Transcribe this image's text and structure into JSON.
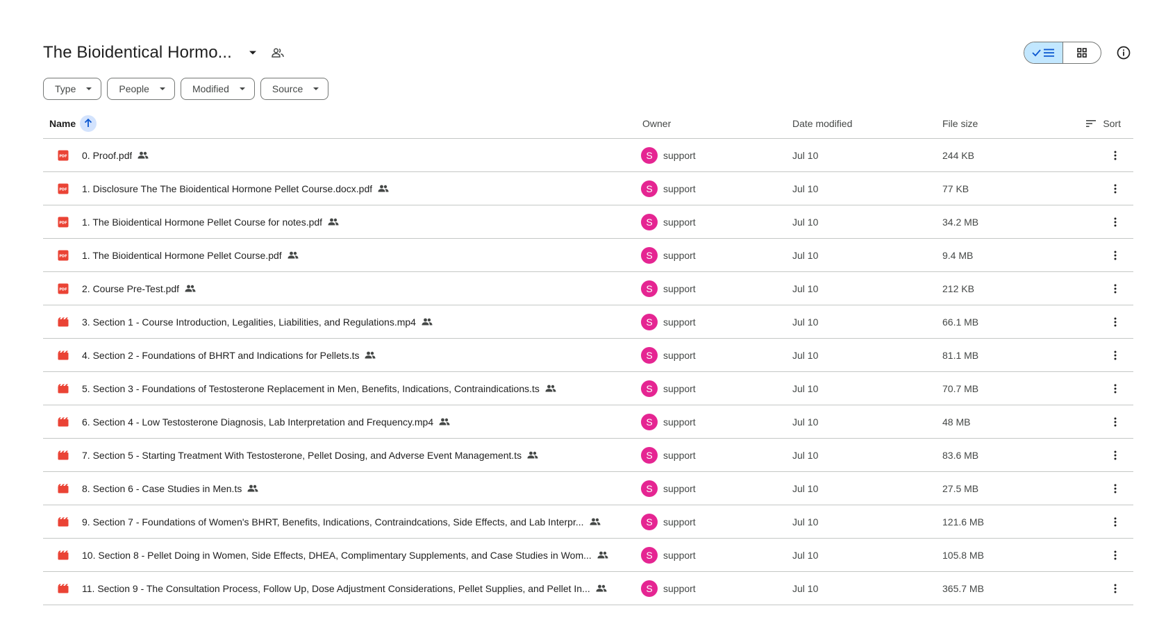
{
  "header": {
    "title": "The Bioidentical Hormo...",
    "shared_icon": "people-outline-icon",
    "view_list_icon": "list-view-icon",
    "view_grid_icon": "grid-view-icon",
    "info_icon": "info-icon"
  },
  "filters": [
    {
      "label": "Type"
    },
    {
      "label": "People"
    },
    {
      "label": "Modified"
    },
    {
      "label": "Source"
    }
  ],
  "columns": {
    "name": "Name",
    "owner": "Owner",
    "date_modified": "Date modified",
    "file_size": "File size",
    "sort": "Sort"
  },
  "colors": {
    "pdf_icon": "#ea4335",
    "video_icon": "#ea4335",
    "avatar_bg": "#e52592",
    "active_view_bg": "#c2e7ff",
    "sort_arrow_bg": "#d3e3fd"
  },
  "files": [
    {
      "name": "0. Proof.pdf",
      "type": "pdf",
      "owner": "support",
      "avatar": "S",
      "date": "Jul 10",
      "size": "244 KB"
    },
    {
      "name": "1. Disclosure The The Bioidentical Hormone Pellet Course.docx.pdf",
      "type": "pdf",
      "owner": "support",
      "avatar": "S",
      "date": "Jul 10",
      "size": "77 KB"
    },
    {
      "name": "1. The Bioidentical Hormone Pellet Course for notes.pdf",
      "type": "pdf",
      "owner": "support",
      "avatar": "S",
      "date": "Jul 10",
      "size": "34.2 MB"
    },
    {
      "name": "1. The Bioidentical Hormone Pellet Course.pdf",
      "type": "pdf",
      "owner": "support",
      "avatar": "S",
      "date": "Jul 10",
      "size": "9.4 MB"
    },
    {
      "name": "2. Course Pre-Test.pdf",
      "type": "pdf",
      "owner": "support",
      "avatar": "S",
      "date": "Jul 10",
      "size": "212 KB"
    },
    {
      "name": "3. Section 1 - Course Introduction, Legalities, Liabilities, and Regulations.mp4",
      "type": "video",
      "owner": "support",
      "avatar": "S",
      "date": "Jul 10",
      "size": "66.1 MB"
    },
    {
      "name": "4. Section 2 - Foundations of BHRT and Indications for Pellets.ts",
      "type": "video",
      "owner": "support",
      "avatar": "S",
      "date": "Jul 10",
      "size": "81.1 MB"
    },
    {
      "name": "5. Section 3 - Foundations of Testosterone Replacement in Men, Benefits, Indications, Contraindications.ts",
      "type": "video",
      "owner": "support",
      "avatar": "S",
      "date": "Jul 10",
      "size": "70.7 MB"
    },
    {
      "name": "6. Section 4 - Low Testosterone Diagnosis, Lab Interpretation and Frequency.mp4",
      "type": "video",
      "owner": "support",
      "avatar": "S",
      "date": "Jul 10",
      "size": "48 MB"
    },
    {
      "name": "7. Section 5 - Starting Treatment With Testosterone, Pellet Dosing, and Adverse Event Management.ts",
      "type": "video",
      "owner": "support",
      "avatar": "S",
      "date": "Jul 10",
      "size": "83.6 MB"
    },
    {
      "name": "8. Section 6 - Case Studies in Men.ts",
      "type": "video",
      "owner": "support",
      "avatar": "S",
      "date": "Jul 10",
      "size": "27.5 MB"
    },
    {
      "name": "9. Section 7 - Foundations of Women's BHRT, Benefits, Indications, Contraindcations, Side Effects, and Lab Interpr...",
      "type": "video",
      "owner": "support",
      "avatar": "S",
      "date": "Jul 10",
      "size": "121.6 MB"
    },
    {
      "name": "10. Section 8 - Pellet Doing in Women, Side Effects, DHEA, Complimentary Supplements, and Case Studies in Wom...",
      "type": "video",
      "owner": "support",
      "avatar": "S",
      "date": "Jul 10",
      "size": "105.8 MB"
    },
    {
      "name": "11. Section 9 - The Consultation Process, Follow Up, Dose Adjustment Considerations, Pellet Supplies, and Pellet In...",
      "type": "video",
      "owner": "support",
      "avatar": "S",
      "date": "Jul 10",
      "size": "365.7 MB"
    }
  ]
}
